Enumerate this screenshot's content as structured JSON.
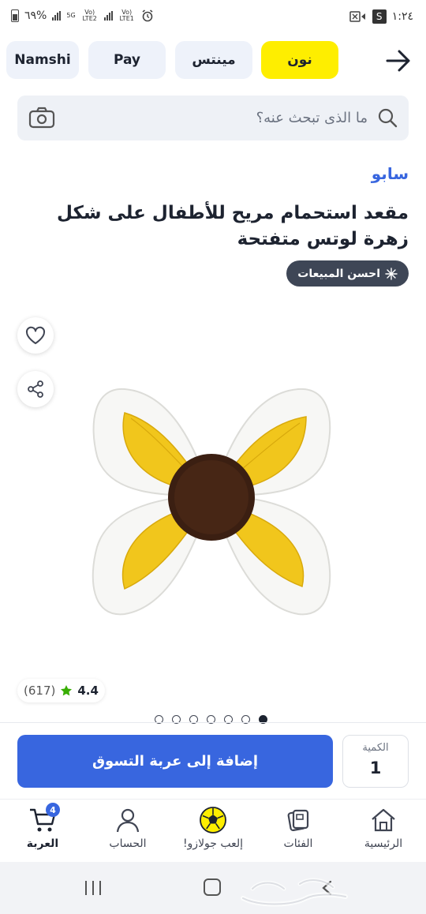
{
  "status_bar": {
    "time": "١:٢٤",
    "battery": "٦٩%",
    "network_5g": "5G",
    "sim1": "Vo) LTE2",
    "sim2": "Vo) LTE1",
    "s_badge": "S"
  },
  "store_tabs": [
    {
      "label": "نون",
      "active": true
    },
    {
      "label": "مينتس",
      "active": false
    },
    {
      "label": "Pay",
      "active": false
    },
    {
      "label": "Namshi",
      "active": false
    }
  ],
  "search": {
    "placeholder": "ما الذى تبحث عنه؟",
    "value": ""
  },
  "product": {
    "brand": "سابو",
    "title": "مقعد استحمام مريح للأطفال على شكل زهرة لوتس متفتحة",
    "badge": "احسن المبيعات",
    "image_icon": "lotus-bath-seat",
    "rating_score": "4.4",
    "rating_count": "(617)",
    "image_count": 7,
    "active_image_index": 6
  },
  "purchase": {
    "add_to_cart_label": "إضافة إلى عربة التسوق",
    "quantity_label": "الكمية",
    "quantity_value": "1"
  },
  "bottom_nav": [
    {
      "label": "الرئيسية",
      "icon": "home-icon"
    },
    {
      "label": "الفئات",
      "icon": "categories-icon"
    },
    {
      "label": "إلعب جولازو!",
      "icon": "football-icon"
    },
    {
      "label": "الحساب",
      "icon": "account-icon"
    },
    {
      "label": "العربة",
      "icon": "cart-icon",
      "badge": "4"
    }
  ],
  "colors": {
    "accent_blue": "#3866df",
    "noon_yellow": "#feee00",
    "text_dark": "#1d2330",
    "rating_green": "#38ae04"
  }
}
